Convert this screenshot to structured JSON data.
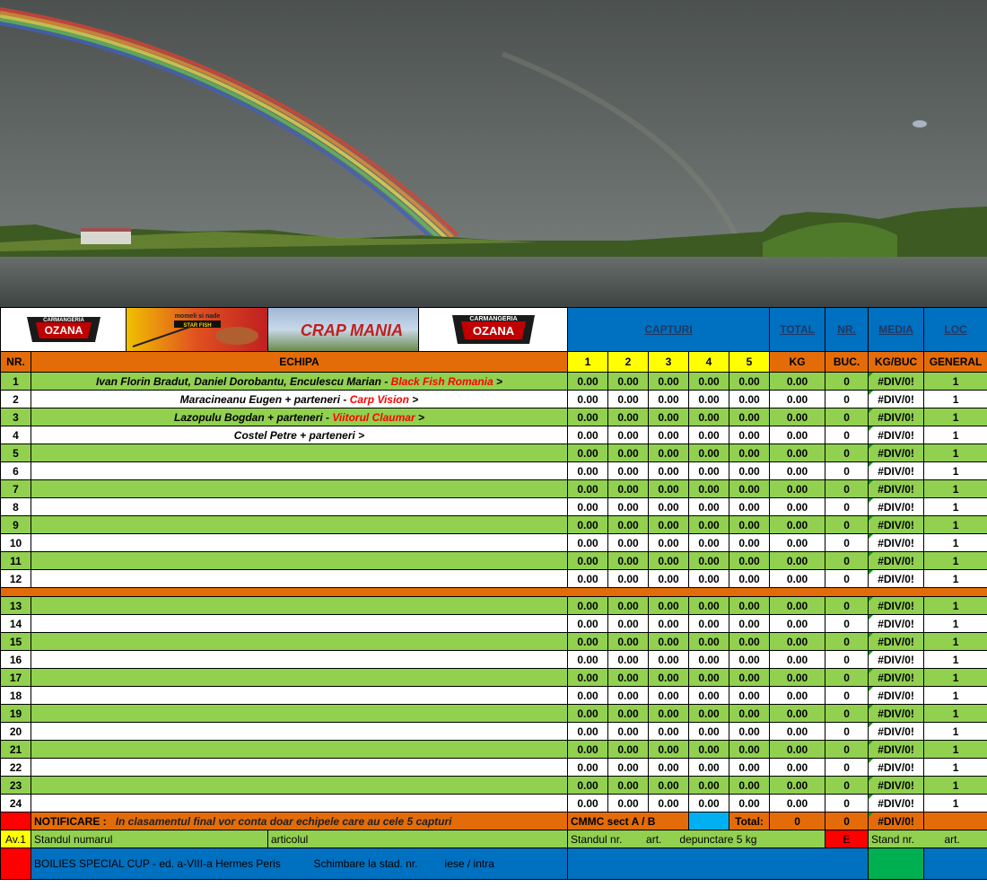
{
  "header": {
    "capturi": "CAPTURI",
    "total": "TOTAL",
    "nr": "NR.",
    "media": "MEDIA",
    "loc": "LOC",
    "col_nr": "NR.",
    "col_echipa": "ECHIPA",
    "cap": [
      "1",
      "2",
      "3",
      "4",
      "5"
    ],
    "kg": "KG",
    "buc": "BUC.",
    "kgbuc": "KG/BUC",
    "general": "GENERAL"
  },
  "logos": {
    "ozana_title": "CARMANGERIA",
    "ozana_name": "OZANA",
    "ozana_sub": "ANGAJ ROLUBELL",
    "nada_text": "momeli si nade",
    "nada_brand": "STAR FISH",
    "carp_text": "CRAP MANIA"
  },
  "teams": [
    {
      "nr": "1",
      "name": "Ivan Florin Bradut, Daniel Dorobantu, Enculescu Marian  -  ",
      "club": "Black Fish Romania",
      "end": "  >",
      "c": [
        "0.00",
        "0.00",
        "0.00",
        "0.00",
        "0.00"
      ],
      "kg": "0.00",
      "buc": "0",
      "kgbuc": "#DIV/0!",
      "loc": "1"
    },
    {
      "nr": "2",
      "name": "Maracineanu  Eugen + parteneri  -  ",
      "club": "Carp Vision",
      "end": "  >",
      "c": [
        "0.00",
        "0.00",
        "0.00",
        "0.00",
        "0.00"
      ],
      "kg": "0.00",
      "buc": "0",
      "kgbuc": "#DIV/0!",
      "loc": "1"
    },
    {
      "nr": "3",
      "name": "Lazopulu Bogdan + parteneri  -  ",
      "club": "Viitorul Claumar",
      "end": "  >",
      "c": [
        "0.00",
        "0.00",
        "0.00",
        "0.00",
        "0.00"
      ],
      "kg": "0.00",
      "buc": "0",
      "kgbuc": "#DIV/0!",
      "loc": "1"
    },
    {
      "nr": "4",
      "name": "Costel Petre + parteneri  >",
      "club": "",
      "end": "",
      "c": [
        "0.00",
        "0.00",
        "0.00",
        "0.00",
        "0.00"
      ],
      "kg": "0.00",
      "buc": "0",
      "kgbuc": "#DIV/0!",
      "loc": "1"
    },
    {
      "nr": "5",
      "name": "",
      "club": "",
      "end": "",
      "c": [
        "0.00",
        "0.00",
        "0.00",
        "0.00",
        "0.00"
      ],
      "kg": "0.00",
      "buc": "0",
      "kgbuc": "#DIV/0!",
      "loc": "1"
    },
    {
      "nr": "6",
      "name": "",
      "club": "",
      "end": "",
      "c": [
        "0.00",
        "0.00",
        "0.00",
        "0.00",
        "0.00"
      ],
      "kg": "0.00",
      "buc": "0",
      "kgbuc": "#DIV/0!",
      "loc": "1"
    },
    {
      "nr": "7",
      "name": "",
      "club": "",
      "end": "",
      "c": [
        "0.00",
        "0.00",
        "0.00",
        "0.00",
        "0.00"
      ],
      "kg": "0.00",
      "buc": "0",
      "kgbuc": "#DIV/0!",
      "loc": "1"
    },
    {
      "nr": "8",
      "name": "",
      "club": "",
      "end": "",
      "c": [
        "0.00",
        "0.00",
        "0.00",
        "0.00",
        "0.00"
      ],
      "kg": "0.00",
      "buc": "0",
      "kgbuc": "#DIV/0!",
      "loc": "1"
    },
    {
      "nr": "9",
      "name": "",
      "club": "",
      "end": "",
      "c": [
        "0.00",
        "0.00",
        "0.00",
        "0.00",
        "0.00"
      ],
      "kg": "0.00",
      "buc": "0",
      "kgbuc": "#DIV/0!",
      "loc": "1"
    },
    {
      "nr": "10",
      "name": "",
      "club": "",
      "end": "",
      "c": [
        "0.00",
        "0.00",
        "0.00",
        "0.00",
        "0.00"
      ],
      "kg": "0.00",
      "buc": "0",
      "kgbuc": "#DIV/0!",
      "loc": "1"
    },
    {
      "nr": "11",
      "name": "",
      "club": "",
      "end": "",
      "c": [
        "0.00",
        "0.00",
        "0.00",
        "0.00",
        "0.00"
      ],
      "kg": "0.00",
      "buc": "0",
      "kgbuc": "#DIV/0!",
      "loc": "1"
    },
    {
      "nr": "12",
      "name": "",
      "club": "",
      "end": "",
      "c": [
        "0.00",
        "0.00",
        "0.00",
        "0.00",
        "0.00"
      ],
      "kg": "0.00",
      "buc": "0",
      "kgbuc": "#DIV/0!",
      "loc": "1"
    }
  ],
  "teams_b": [
    {
      "nr": "13",
      "c": [
        "0.00",
        "0.00",
        "0.00",
        "0.00",
        "0.00"
      ],
      "kg": "0.00",
      "buc": "0",
      "kgbuc": "#DIV/0!",
      "loc": "1"
    },
    {
      "nr": "14",
      "c": [
        "0.00",
        "0.00",
        "0.00",
        "0.00",
        "0.00"
      ],
      "kg": "0.00",
      "buc": "0",
      "kgbuc": "#DIV/0!",
      "loc": "1"
    },
    {
      "nr": "15",
      "c": [
        "0.00",
        "0.00",
        "0.00",
        "0.00",
        "0.00"
      ],
      "kg": "0.00",
      "buc": "0",
      "kgbuc": "#DIV/0!",
      "loc": "1"
    },
    {
      "nr": "16",
      "c": [
        "0.00",
        "0.00",
        "0.00",
        "0.00",
        "0.00"
      ],
      "kg": "0.00",
      "buc": "0",
      "kgbuc": "#DIV/0!",
      "loc": "1"
    },
    {
      "nr": "17",
      "c": [
        "0.00",
        "0.00",
        "0.00",
        "0.00",
        "0.00"
      ],
      "kg": "0.00",
      "buc": "0",
      "kgbuc": "#DIV/0!",
      "loc": "1"
    },
    {
      "nr": "18",
      "c": [
        "0.00",
        "0.00",
        "0.00",
        "0.00",
        "0.00"
      ],
      "kg": "0.00",
      "buc": "0",
      "kgbuc": "#DIV/0!",
      "loc": "1"
    },
    {
      "nr": "19",
      "c": [
        "0.00",
        "0.00",
        "0.00",
        "0.00",
        "0.00"
      ],
      "kg": "0.00",
      "buc": "0",
      "kgbuc": "#DIV/0!",
      "loc": "1"
    },
    {
      "nr": "20",
      "c": [
        "0.00",
        "0.00",
        "0.00",
        "0.00",
        "0.00"
      ],
      "kg": "0.00",
      "buc": "0",
      "kgbuc": "#DIV/0!",
      "loc": "1"
    },
    {
      "nr": "21",
      "c": [
        "0.00",
        "0.00",
        "0.00",
        "0.00",
        "0.00"
      ],
      "kg": "0.00",
      "buc": "0",
      "kgbuc": "#DIV/0!",
      "loc": "1"
    },
    {
      "nr": "22",
      "c": [
        "0.00",
        "0.00",
        "0.00",
        "0.00",
        "0.00"
      ],
      "kg": "0.00",
      "buc": "0",
      "kgbuc": "#DIV/0!",
      "loc": "1"
    },
    {
      "nr": "23",
      "c": [
        "0.00",
        "0.00",
        "0.00",
        "0.00",
        "0.00"
      ],
      "kg": "0.00",
      "buc": "0",
      "kgbuc": "#DIV/0!",
      "loc": "1"
    },
    {
      "nr": "24",
      "c": [
        "0.00",
        "0.00",
        "0.00",
        "0.00",
        "0.00"
      ],
      "kg": "0.00",
      "buc": "0",
      "kgbuc": "#DIV/0!",
      "loc": "1"
    }
  ],
  "footer": {
    "notificare_label": "NOTIFICARE :",
    "notificare_text": "In clasamentul final vor conta doar echipele care au cele 5 capturi",
    "cmmc": "CMMC sect  A / B",
    "total_label": "Total:",
    "total_kg": "0",
    "total_buc": "0",
    "total_media": "#DIV/0!",
    "av": "Av.1",
    "standul_numarul": "Standul numarul",
    "articolul": "articolul",
    "standul_nr": "Standul  nr.",
    "art": "art.",
    "depunctare": "depunctare 5 kg",
    "e_mark": "E",
    "stand_nr": "Stand nr.",
    "art2": "art.",
    "cup": "BOILIES SPECIAL CUP - ed. a-VIII-a Hermes Peris",
    "schimbare": "Schimbare la stad.  nr.",
    "iese_intra": "iese / intra"
  }
}
